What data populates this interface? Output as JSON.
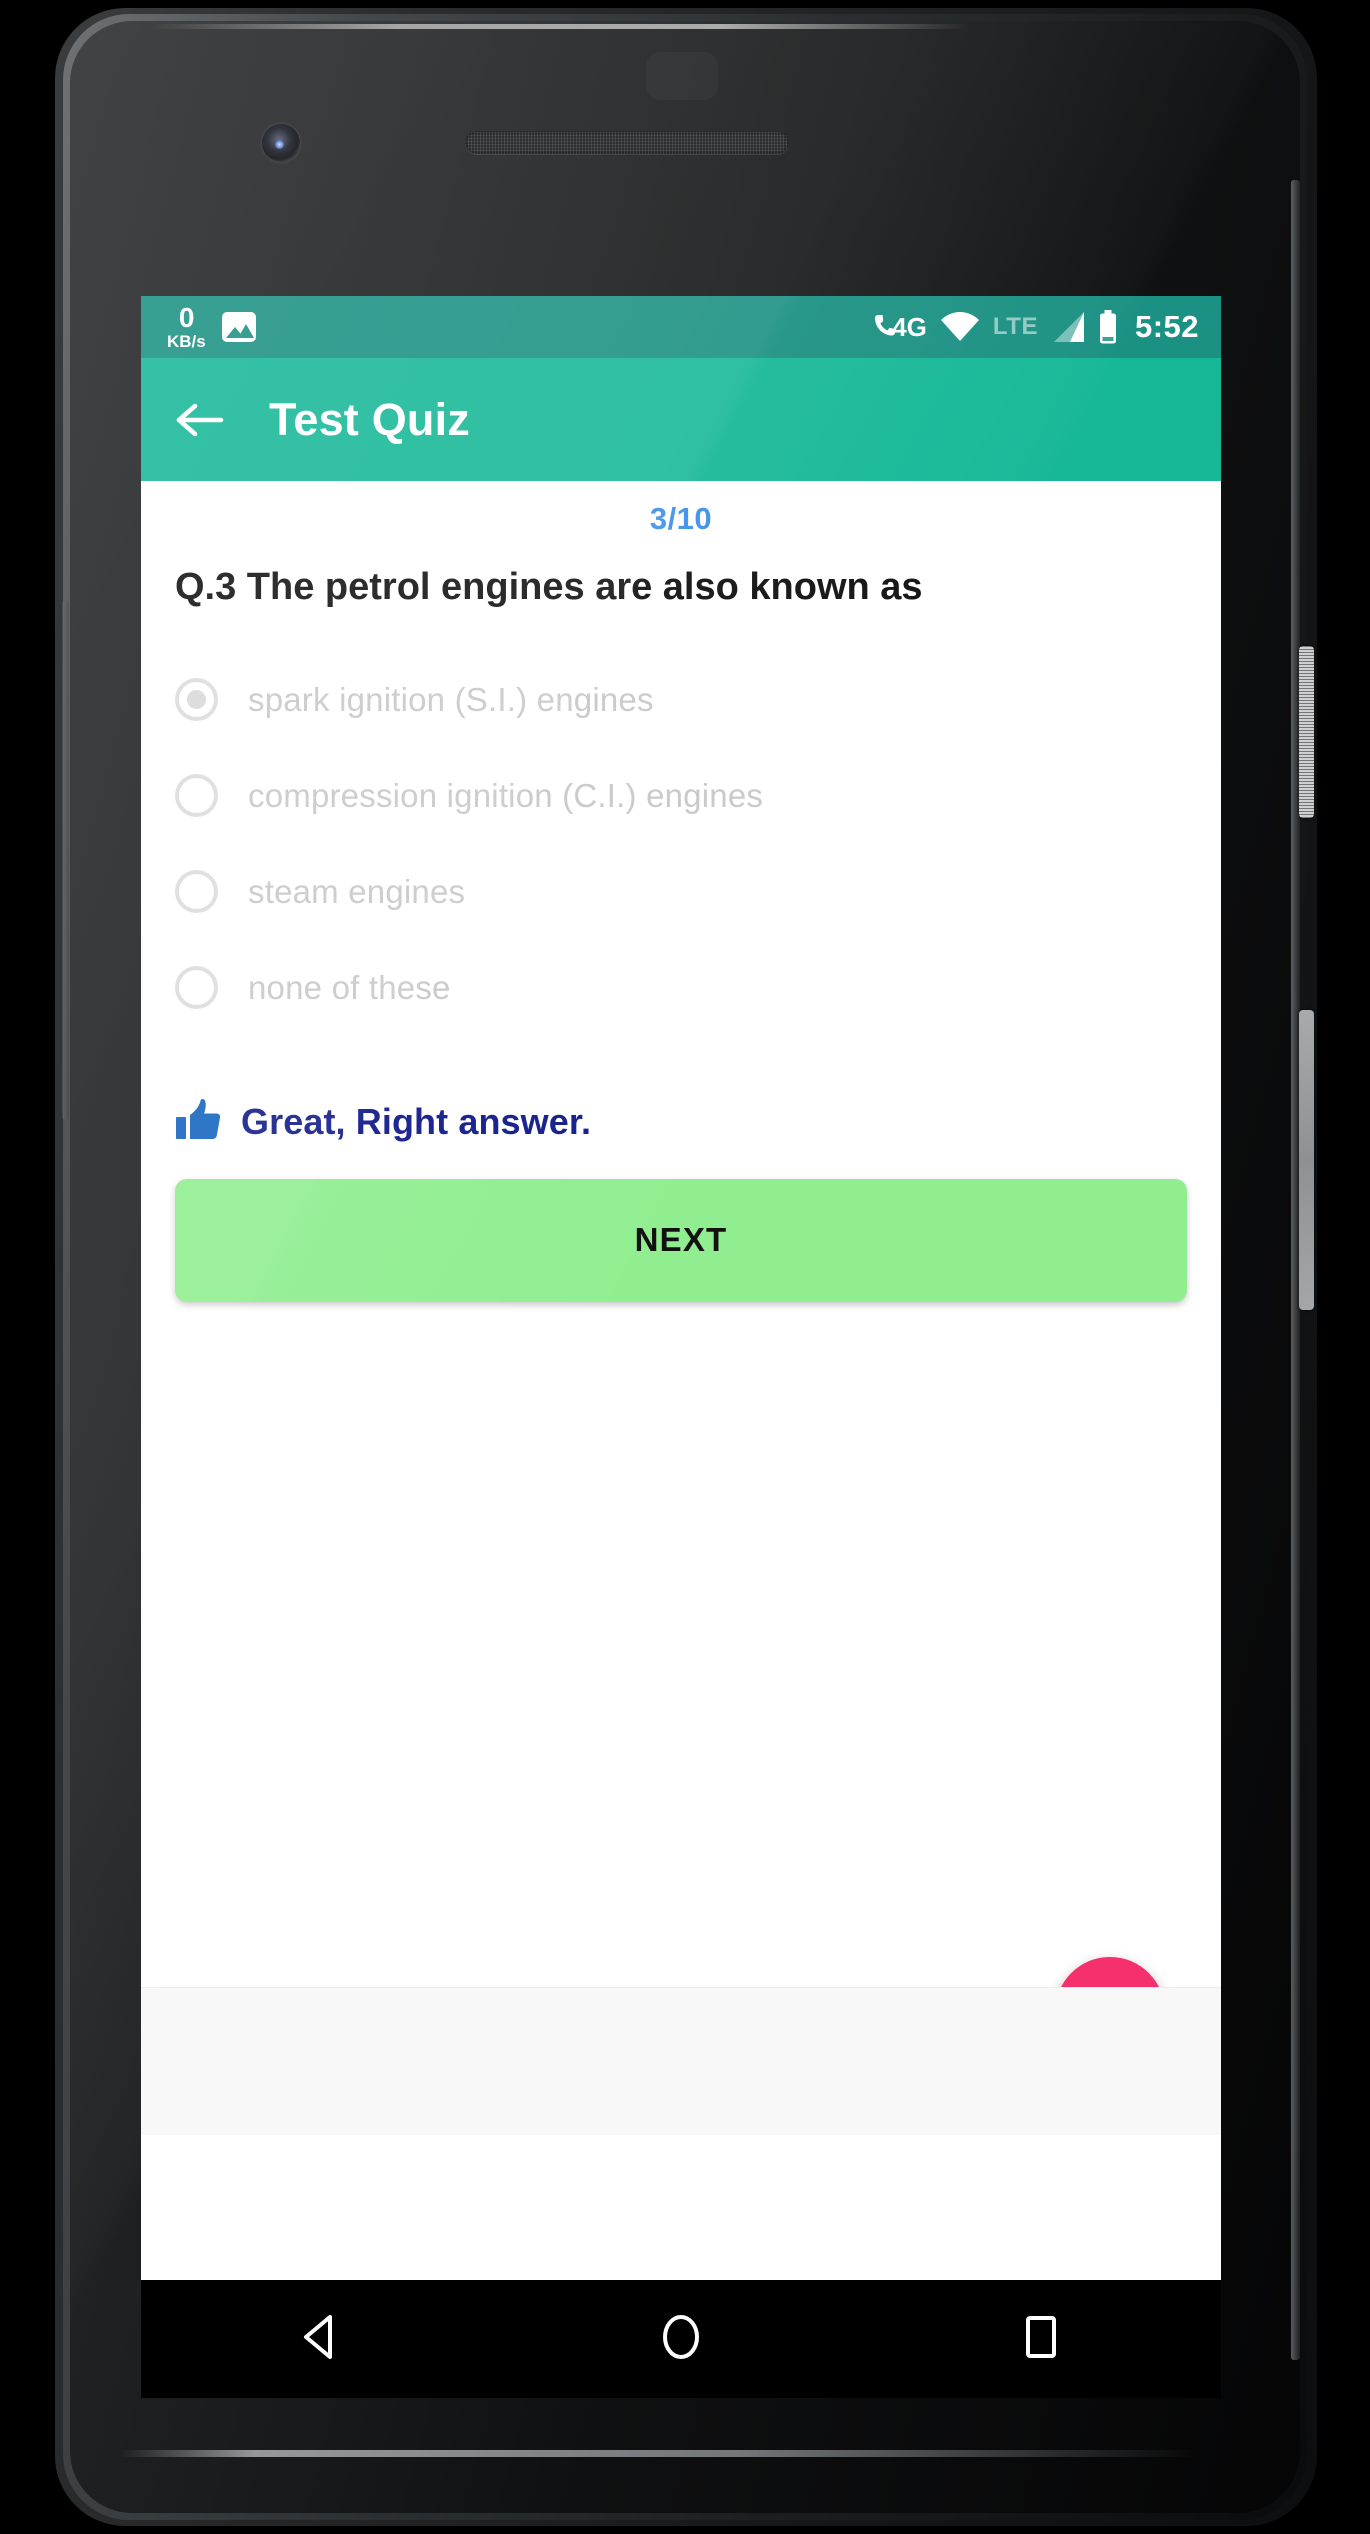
{
  "device": {
    "name": "android-phone",
    "front_camera": "front-camera",
    "earpiece": "earpiece-speaker",
    "bottom_speaker": "bottom-speaker",
    "power_button": "power-button",
    "volume_button": "volume-rocker"
  },
  "status_bar": {
    "background_color": "#1b9183",
    "network_speed_value": "0",
    "network_speed_unit": "KB/s",
    "gallery_icon": "gallery-icon",
    "call_4g_label": "4G",
    "wifi_icon": "wifi-icon",
    "lte_label": "LTE",
    "signal_icon": "signal-bars-icon",
    "battery_icon": "battery-icon",
    "clock": "5:52"
  },
  "app_bar": {
    "background_color": "#17b897",
    "back_icon": "back-arrow-icon",
    "title": "Test Quiz"
  },
  "quiz": {
    "progress": "3/10",
    "progress_color": "#3b8fe8",
    "question": "Q.3 The petrol engines are also known as",
    "options": [
      {
        "label": "spark ignition (S.I.) engines",
        "selected": true
      },
      {
        "label": "compression ignition (C.I.) engines",
        "selected": false
      },
      {
        "label": "steam engines",
        "selected": false
      },
      {
        "label": "none of these",
        "selected": false
      }
    ],
    "feedback": {
      "icon": "thumbs-up-icon",
      "icon_color": "#1565c0",
      "text": "Great, Right answer.",
      "text_color": "#111b8a"
    },
    "next_button": {
      "label": "NEXT",
      "background_color": "#90ee90",
      "text_color": "#111111"
    },
    "fab": {
      "icon": "search-icon",
      "background_color": "#f5316d"
    },
    "ad_banner": {
      "background_color": "#f8f8f8"
    }
  },
  "nav_bar": {
    "back": "back-triangle-icon",
    "home": "home-circle-icon",
    "recents": "recents-square-icon"
  }
}
